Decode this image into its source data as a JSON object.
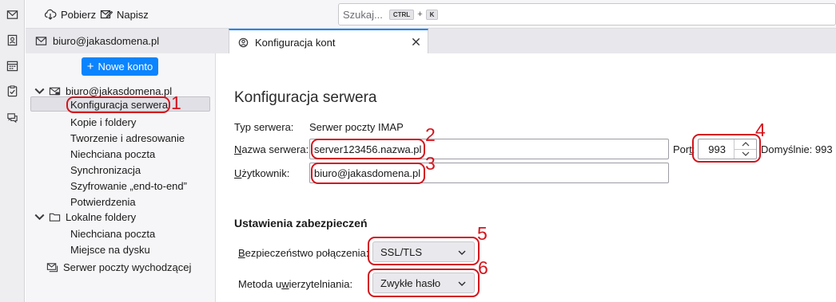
{
  "spaces": [
    {
      "icon": "mail-icon"
    },
    {
      "icon": "address-book-icon"
    },
    {
      "icon": "calendar-icon"
    },
    {
      "icon": "tasks-icon"
    },
    {
      "icon": "chat-icon"
    }
  ],
  "toolbar": {
    "get_messages_label": "Pobierz",
    "write_label": "Napisz",
    "search_placeholder": "Szukaj...",
    "search_shortcut_ctrl": "CTRL",
    "search_shortcut_plus": "+",
    "search_shortcut_key": "K"
  },
  "tabs": [
    {
      "label": "biuro@jakasdomena.pl",
      "icon": "mail-icon",
      "active": false
    },
    {
      "label": "Konfiguracja kont",
      "icon": "settings-icon",
      "active": true
    }
  ],
  "sidebar": {
    "new_account_label": "Nowe konto",
    "new_account_plus": "+",
    "account": "biuro@jakasdomena.pl",
    "account_items": [
      "Konfiguracja serwera",
      "Kopie i foldery",
      "Tworzenie i adresowanie",
      "Niechciana poczta",
      "Synchronizacja",
      "Szyfrowanie „end-to-end”",
      "Potwierdzenia"
    ],
    "local_folders": "Lokalne foldery",
    "local_items": [
      "Niechciana poczta",
      "Miejsce na dysku"
    ],
    "outgoing": "Serwer poczty wychodzącej"
  },
  "main": {
    "title": "Konfiguracja serwera",
    "server_type_label": "Typ serwera:",
    "server_type_value": "Serwer poczty IMAP",
    "server_name_label_u": "N",
    "server_name_label_rest": "azwa serwera:",
    "server_name_value": "server123456.nazwa.pl",
    "port_label_pre": "Por",
    "port_label_u": "t",
    "port_label_post": ":",
    "port_value": "993",
    "default_label": "Domyślnie: 993",
    "user_label_u": "U",
    "user_label_rest": "żytkownik:",
    "user_value": "biuro@jakasdomena.pl",
    "security_heading": "Ustawienia zabezpieczeń",
    "conn_security_label_u": "B",
    "conn_security_label_rest": "ezpieczeństwo połączenia:",
    "conn_security_value": "SSL/TLS",
    "auth_label_pre": "Metoda u",
    "auth_label_u": "w",
    "auth_label_rest": "ierzytelniania:",
    "auth_value": "Zwykłe hasło"
  },
  "annotations": {
    "color": "#d4141c",
    "numbers": [
      "1",
      "2",
      "3",
      "4",
      "5",
      "6"
    ]
  },
  "colors": {
    "accent": "#0a84ff",
    "annotation": "#d4141c"
  }
}
